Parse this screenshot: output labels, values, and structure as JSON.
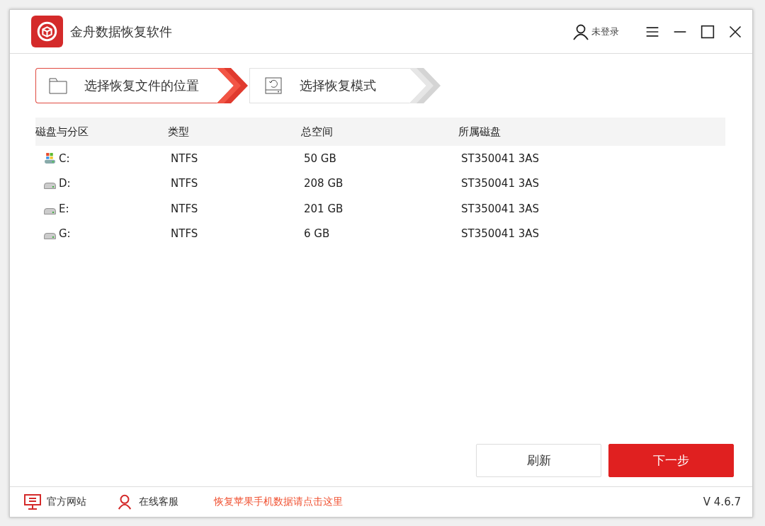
{
  "window": {
    "title": "金舟数据恢复软件",
    "user": "未登录"
  },
  "steps": [
    {
      "label": "选择恢复文件的位置",
      "kind": "folder",
      "selected": true
    },
    {
      "label": "选择恢复模式",
      "kind": "disk",
      "selected": false
    }
  ],
  "table": {
    "columns": [
      "磁盘与分区",
      "类型",
      "总空间",
      "所属磁盘"
    ],
    "rows": [
      {
        "kind": "system",
        "name": "C:",
        "type": "NTFS",
        "size": "50 GB",
        "disk": "ST350041 3AS"
      },
      {
        "kind": "drive",
        "name": "D:",
        "type": "NTFS",
        "size": "208 GB",
        "disk": "ST350041 3AS"
      },
      {
        "kind": "drive",
        "name": "E:",
        "type": "NTFS",
        "size": "201 GB",
        "disk": "ST350041 3AS"
      },
      {
        "kind": "drive",
        "name": "G:",
        "type": "NTFS",
        "size": "6 GB",
        "disk": "ST350041 3AS"
      }
    ]
  },
  "buttons": {
    "refresh": "刷新",
    "next": "下一步"
  },
  "status_bar": {
    "website": "官方网站",
    "support": "在线客服",
    "promo": "恢复苹果手机数据请点击这里",
    "version": "V 4.6.7"
  }
}
